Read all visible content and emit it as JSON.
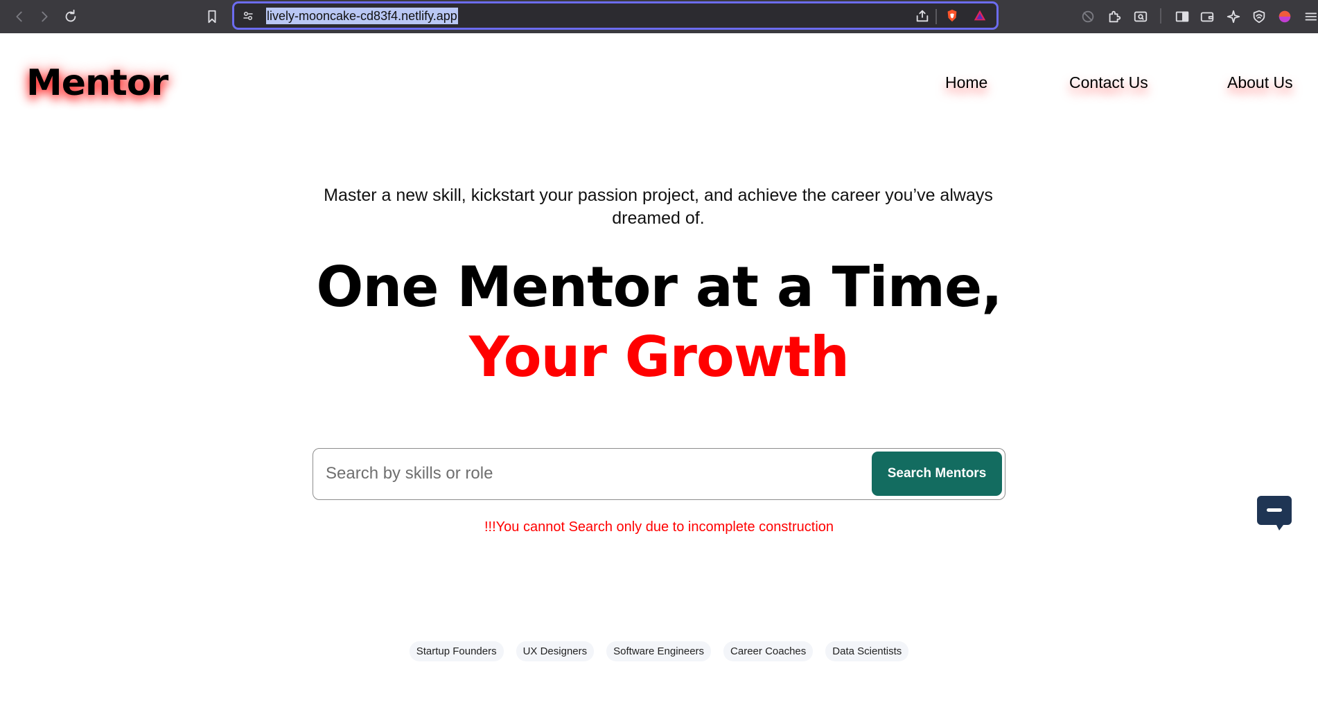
{
  "browser": {
    "url": "lively-mooncake-cd83f4.netlify.app"
  },
  "site": {
    "brand": "Mentor",
    "nav": [
      {
        "label": "Home"
      },
      {
        "label": "Contact Us"
      },
      {
        "label": "About Us"
      }
    ]
  },
  "hero": {
    "tagline": "Master a new skill, kickstart your passion project, and achieve the career you’ve always dreamed of.",
    "headline_line1": "One Mentor at a Time,",
    "headline_line2": "Your Growth",
    "search_placeholder": "Search by skills or role",
    "search_button": "Search Mentors",
    "warning": "!!!You cannot Search only due to incomplete construction",
    "tags": [
      "Startup Founders",
      "UX Designers",
      "Software Engineers",
      "Career Coaches",
      "Data Scientists"
    ]
  },
  "colors": {
    "accent_red": "#ff0000",
    "button_teal": "#136c60",
    "chat_navy": "#1f3554",
    "url_focus": "#6c6cf0"
  }
}
